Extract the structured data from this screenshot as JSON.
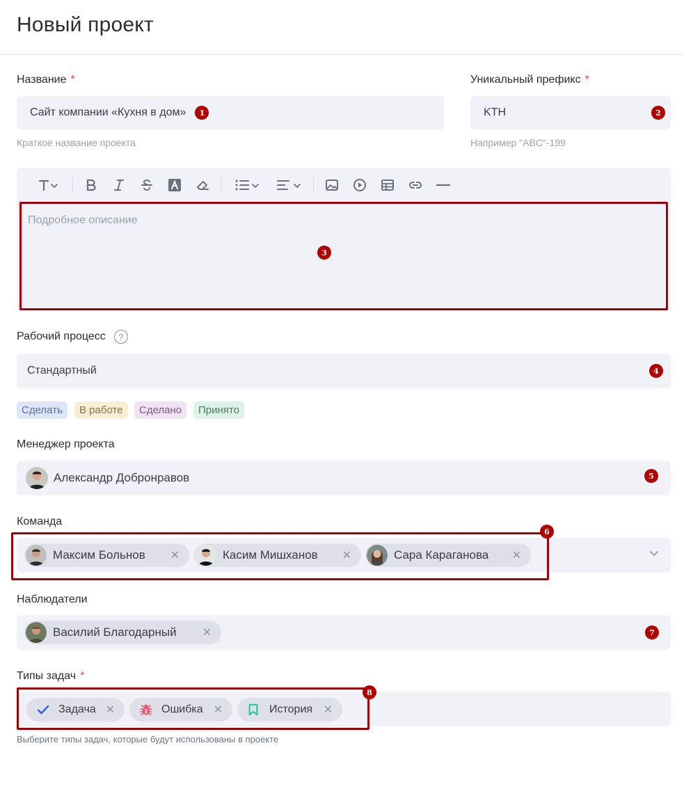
{
  "page": {
    "title": "Новый проект"
  },
  "name_field": {
    "label": "Название",
    "required": "*",
    "value": "Сайт компании «Кухня в дом»",
    "hint": "Краткое название проекта",
    "badge": "1"
  },
  "prefix_field": {
    "label": "Уникальный префикс",
    "required": "*",
    "value": "KTH",
    "hint": "Например \"ABC\"-199",
    "badge": "2"
  },
  "editor": {
    "toolbar": [
      "text-style-icon",
      "bold-icon",
      "italic-icon",
      "strikethrough-icon",
      "text-color-icon",
      "eraser-icon",
      "bullet-list-icon",
      "align-icon",
      "image-icon",
      "video-icon",
      "table-icon",
      "link-icon",
      "horizontal-rule-icon"
    ],
    "placeholder": "Подробное описание",
    "badge": "3"
  },
  "workflow": {
    "label": "Рабочий процесс",
    "value": "Стандартный",
    "badge": "4",
    "statuses": [
      {
        "label": "Сделать",
        "bg": "#dde6fb",
        "color": "#5a6f9e"
      },
      {
        "label": "В работе",
        "bg": "#fbeed2",
        "color": "#8a7340"
      },
      {
        "label": "Сделано",
        "bg": "#f1e2f4",
        "color": "#7c5a86"
      },
      {
        "label": "Принято",
        "bg": "#dcf3e6",
        "color": "#4e7a61"
      }
    ]
  },
  "manager": {
    "label": "Менеджер проекта",
    "value": "Александр Добронравов",
    "badge": "5"
  },
  "team": {
    "label": "Команда",
    "badge": "6",
    "members": [
      "Максим Больнов",
      "Касим Мишханов",
      "Сара Караганова"
    ],
    "remove": "✕"
  },
  "watchers": {
    "label": "Наблюдатели",
    "badge": "7",
    "members": [
      "Василий Благодарный"
    ],
    "remove": "✕"
  },
  "task_types": {
    "label": "Типы задач",
    "required": "*",
    "badge": "8",
    "items": [
      {
        "label": "Задача",
        "icon": "check-icon",
        "color": "#2f5ee5"
      },
      {
        "label": "Ошибка",
        "icon": "bug-icon",
        "color": "#ef4d6b"
      },
      {
        "label": "История",
        "icon": "bookmark-icon",
        "color": "#1ec0a0"
      }
    ],
    "remove": "✕",
    "hint": "Выберите типы задач, которые будут использованы в проекте"
  }
}
